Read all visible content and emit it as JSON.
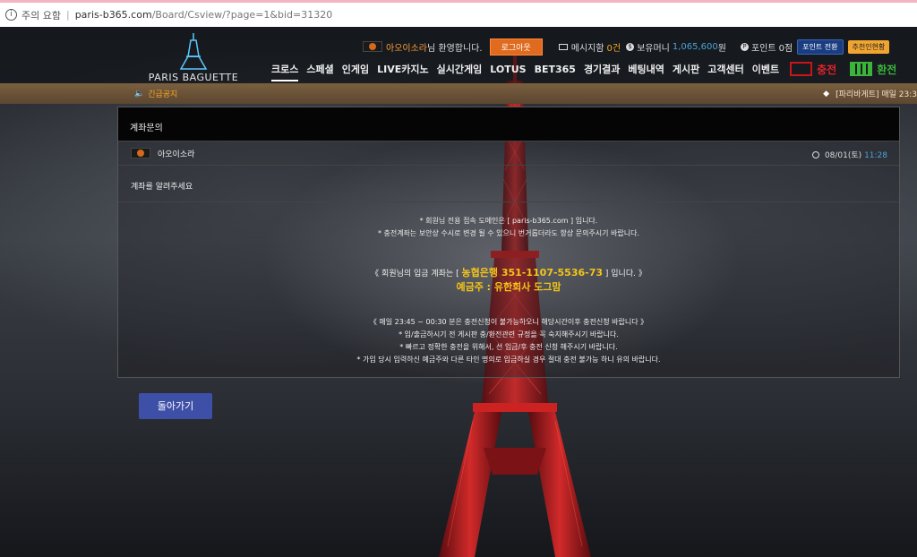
{
  "browser": {
    "security_label": "주의 요함",
    "url_host": "paris-b365.com",
    "url_path": "/Board/Csview/?page=1&bid=31320"
  },
  "site": {
    "brand": "PARIS BAGUETTE"
  },
  "user": {
    "name": "아오이소라",
    "welcome_suffix": "님 환영합니다.",
    "logout": "로그아웃",
    "message_label": "메시지함",
    "message_count": "0건",
    "money_label": "보유머니",
    "money_value": "1,065,600",
    "money_unit": "원",
    "point_label": "포인트",
    "point_value": "0점",
    "point_convert": "포인트 전환",
    "recommend": "추천인현황"
  },
  "nav": {
    "items": [
      "크로스",
      "스페셜",
      "인게임",
      "LIVE카지노",
      "실시간게임",
      "LOTUS",
      "BET365",
      "경기결과",
      "베팅내역",
      "게시판",
      "고객센터",
      "이벤트"
    ],
    "charge": "충전",
    "exchange": "환전"
  },
  "notice": {
    "label": "긴급공지",
    "ticker": "[파리바게트]   매일 23:3"
  },
  "post": {
    "board_title": "계좌문의",
    "author": "아오이소라",
    "date": "08/01(토)",
    "time": "11:28",
    "subject": "계좌를 알려주세요",
    "line1": "* 회원님 전용 접속 도메인은 [ paris-b365.com ] 입니다.",
    "line2": "* 충전계좌는 보안상 수시로 변경 될 수 있으니 번거롭더라도 항상 문의주시기 바랍니다.",
    "account_prefix": "《 회원님의 입금 계좌는 [ ",
    "account_value": "농협은행 351-1107-5536-73",
    "account_suffix": " ] 입니다. 》",
    "holder": "예금주 : 유한회사 도그맘",
    "bottom1": "《 매일 23:45 ~ 00:30 분은 충전신청이 불가능하오니 해당시간이후 충전신청 바랍니다 》",
    "bottom2": "* 입/출금하시기 전 게시판 충/환전관련 규정을 꼭 숙지해주시기 바랍니다.",
    "bottom3": "* 빠르고 정확한 충전을 위해서, 선 입금/후 충전 신청 해주시기 바랍니다.",
    "bottom4": "* 가입 당시 입력하신 예금주와 다른 타인 명의로 입금하실 경우 절대 충전 불가능 하니 유의 바랍니다."
  },
  "actions": {
    "back": "돌아가기"
  },
  "colors": {
    "accent_orange": "#e06b1f",
    "money_blue": "#4aa3d8",
    "highlight_yellow": "#f5c518",
    "charge_red": "#e0232a",
    "exchange_green": "#3ab53a",
    "button_blue": "#3e4fa8"
  }
}
